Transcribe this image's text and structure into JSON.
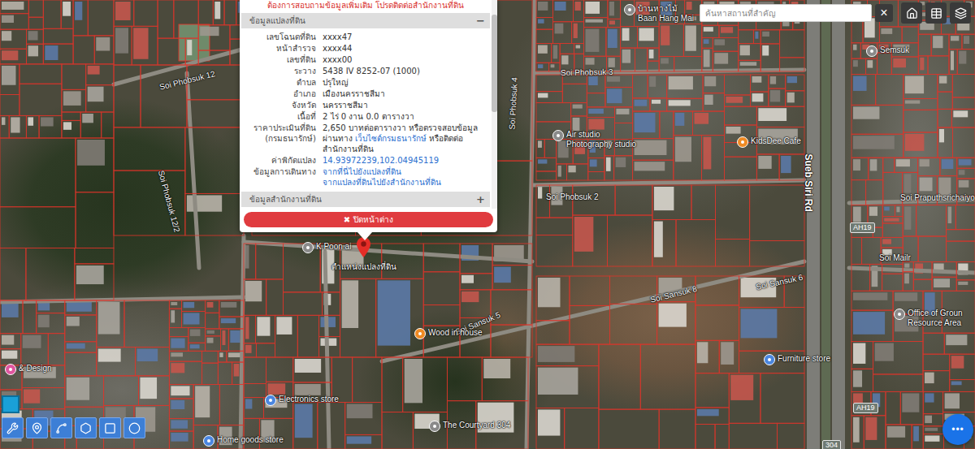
{
  "search": {
    "placeholder": "ค้นหาสถานที่สำคัญ",
    "close": "×"
  },
  "popup": {
    "notice": "ต้องการสอบถามข้อมูลเพิ่มเติม โปรดติดต่อสำนักงานที่ดิน",
    "sections": [
      {
        "title": "ข้อมูลแปลงที่ดิน",
        "toggle": "−",
        "expanded": true,
        "rows": [
          {
            "label": "เลขโฉนดที่ดิน",
            "lines": [
              [
                {
                  "text": "xxxx47",
                  "link": false
                }
              ]
            ]
          },
          {
            "label": "หน้าสำรวจ",
            "lines": [
              [
                {
                  "text": "xxxx44",
                  "link": false
                }
              ]
            ]
          },
          {
            "label": "เลขที่ดิน",
            "lines": [
              [
                {
                  "text": "xxxx00",
                  "link": false
                }
              ]
            ]
          },
          {
            "label": "ระวาง",
            "lines": [
              [
                {
                  "text": "5438 IV 8252-07 (1000)",
                  "link": false
                }
              ]
            ]
          },
          {
            "label": "ตำบล",
            "lines": [
              [
                {
                  "text": "ปรุใหญ่",
                  "link": false
                }
              ]
            ]
          },
          {
            "label": "อำเภอ",
            "lines": [
              [
                {
                  "text": "เมืองนครราชสีมา",
                  "link": false
                }
              ]
            ]
          },
          {
            "label": "จังหวัด",
            "lines": [
              [
                {
                  "text": "นครราชสีมา",
                  "link": false
                }
              ]
            ]
          },
          {
            "label": "เนื้อที่",
            "lines": [
              [
                {
                  "text": "2 ไร่ 0 งาน 0.0 ตารางวา",
                  "link": false
                }
              ]
            ]
          },
          {
            "label": "ราคาประเมินที่ดิน (กรมธนารักษ์)",
            "lines": [
              [
                {
                  "text": "2,650 บาทต่อตารางวา หรือตรวจสอบข้อมูลผ่านทาง ",
                  "link": false
                },
                {
                  "text": "เว็บไซต์กรมธนารักษ์",
                  "link": true
                },
                {
                  "text": " หรือติดต่อสำนักงานที่ดิน",
                  "link": false
                }
              ]
            ]
          },
          {
            "label": "ค่าพิกัดแปลง",
            "lines": [
              [
                {
                  "text": "14.93972239,102.04945119",
                  "link": true
                }
              ]
            ]
          },
          {
            "label": "ข้อมูลการเดินทาง",
            "lines": [
              [
                {
                  "text": "จากที่นี่ไปยังแปลงที่ดิน",
                  "link": true
                }
              ],
              [
                {
                  "text": "จากแปลงที่ดินไปยังสำนักงานที่ดิน",
                  "link": true
                }
              ]
            ]
          }
        ]
      },
      {
        "title": "ข้อมูลสำนักงานที่ดิน",
        "toggle": "+",
        "expanded": false,
        "rows": []
      }
    ],
    "close_button": {
      "icon": "✖",
      "label": "ปิดหน้าต่าง"
    }
  },
  "marker": {
    "label": "ตำแหน่งแปลงที่ดิน"
  },
  "map_labels": [
    {
      "text": "Soi Phobsuk 12",
      "kind": "road"
    },
    {
      "text": "Soi Phobsuk 12/2",
      "kind": "road"
    },
    {
      "text": "Soi Phobsuk 3",
      "kind": "road"
    },
    {
      "text": "Soi Phobsuk 4",
      "kind": "road"
    },
    {
      "text": "Soi Phobsuk 2",
      "kind": "road"
    },
    {
      "text": "Sueb Siri Rd",
      "kind": "main-road"
    },
    {
      "text": "Soi Praputhsrichaiyo",
      "kind": "road"
    },
    {
      "text": "Soi Mailr",
      "kind": "road"
    },
    {
      "text": "Soi Sansuk 6",
      "kind": "road"
    },
    {
      "text": "Soi Sansuk 8",
      "kind": "road"
    },
    {
      "text": "Soi Sansuk 5",
      "kind": "road"
    },
    {
      "text": "AH19",
      "kind": "shield"
    },
    {
      "text": "AH19",
      "kind": "shield"
    },
    {
      "text": "304",
      "kind": "shield"
    },
    {
      "text": "Air studio",
      "sub": "Photography studio",
      "kind": "place",
      "color": "#8a8a8a"
    },
    {
      "text": "KidsDee Cafe",
      "kind": "place",
      "color": "#ef8a23"
    },
    {
      "text": "Wood in house",
      "kind": "place",
      "color": "#ef8a23"
    },
    {
      "text": "K.Poon ai",
      "kind": "place",
      "color": "#8a8a8a"
    },
    {
      "text": "บ้านหางไม้",
      "sub": "Baan Hang Mai",
      "kind": "place",
      "color": "#8a8a8a"
    },
    {
      "text": "Semsuk",
      "kind": "place",
      "color": "#8a8a8a"
    },
    {
      "text": "Office of Groun",
      "sub": "Resource Area",
      "kind": "place",
      "color": "#8a8a8a"
    },
    {
      "text": "The Courtyard 304",
      "kind": "place",
      "color": "#8a8a8a"
    },
    {
      "text": "Furniture store",
      "kind": "place",
      "color": "#4a86e0"
    },
    {
      "text": "& Design",
      "kind": "place",
      "color": "#e0559f"
    },
    {
      "text": "Electronics store",
      "kind": "place",
      "color": "#4a86e0"
    },
    {
      "text": "Home goods store",
      "kind": "place",
      "color": "#4a86e0"
    }
  ],
  "chat_button": {
    "label": "•••"
  }
}
